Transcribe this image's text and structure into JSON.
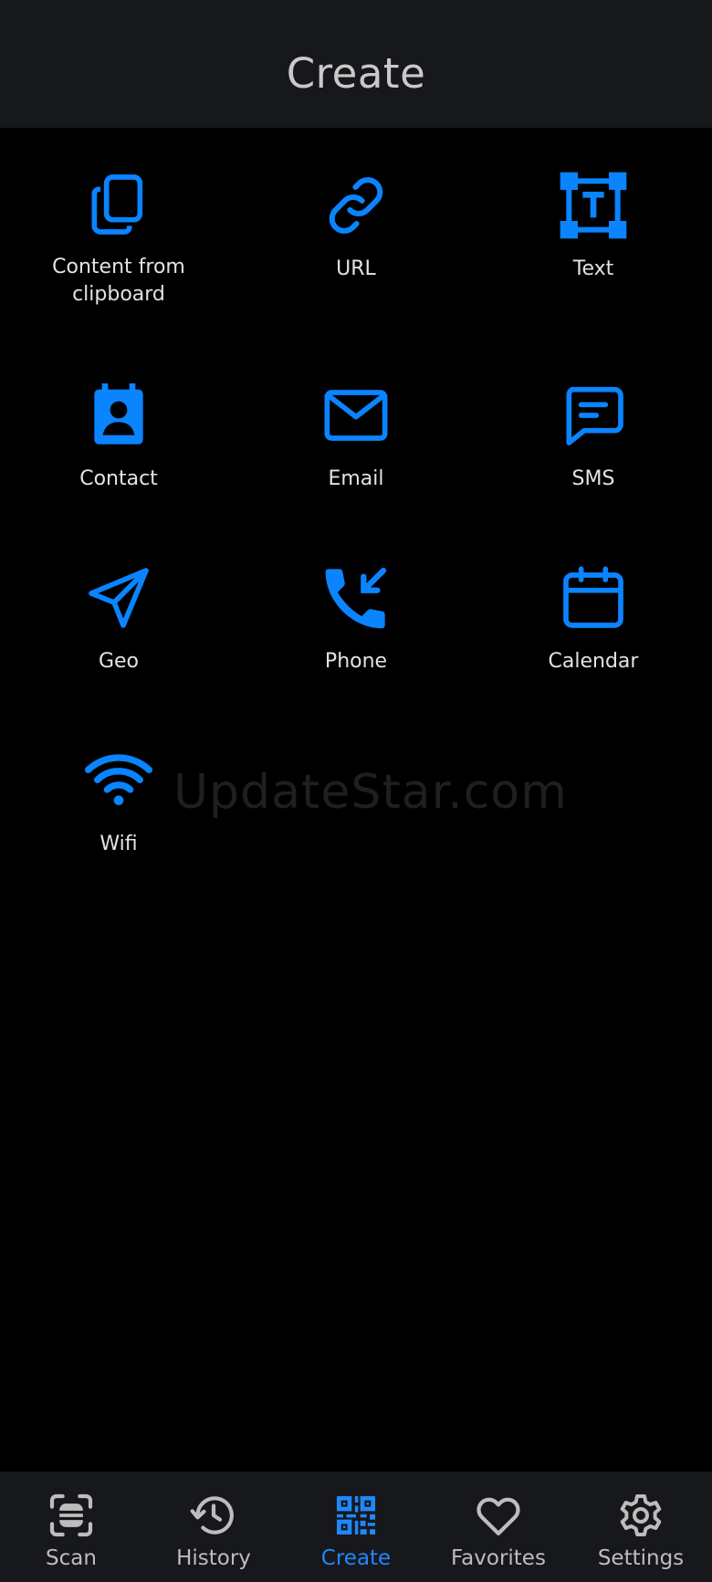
{
  "header": {
    "title": "Create"
  },
  "colors": {
    "accent": "#0a84ff",
    "nav_active": "#1e88ff",
    "nav_inactive": "#bdbdbd",
    "text": "#e3e3e3"
  },
  "tiles": [
    {
      "label": "Content from\nclipboard",
      "icon": "copy-icon"
    },
    {
      "label": "URL",
      "icon": "link-icon"
    },
    {
      "label": "Text",
      "icon": "text-box-icon"
    },
    {
      "label": "Contact",
      "icon": "contact-icon"
    },
    {
      "label": "Email",
      "icon": "mail-icon"
    },
    {
      "label": "SMS",
      "icon": "message-icon"
    },
    {
      "label": "Geo",
      "icon": "navigation-icon"
    },
    {
      "label": "Phone",
      "icon": "phone-incoming-icon"
    },
    {
      "label": "Calendar",
      "icon": "calendar-icon"
    },
    {
      "label": "Wifi",
      "icon": "wifi-icon"
    }
  ],
  "watermark": "UpdateStar.com",
  "bottom_nav": {
    "items": [
      {
        "label": "Scan",
        "icon": "scan-icon",
        "active": false
      },
      {
        "label": "History",
        "icon": "history-icon",
        "active": false
      },
      {
        "label": "Create",
        "icon": "qr-code-icon",
        "active": true
      },
      {
        "label": "Favorites",
        "icon": "heart-icon",
        "active": false
      },
      {
        "label": "Settings",
        "icon": "gear-icon",
        "active": false
      }
    ]
  }
}
